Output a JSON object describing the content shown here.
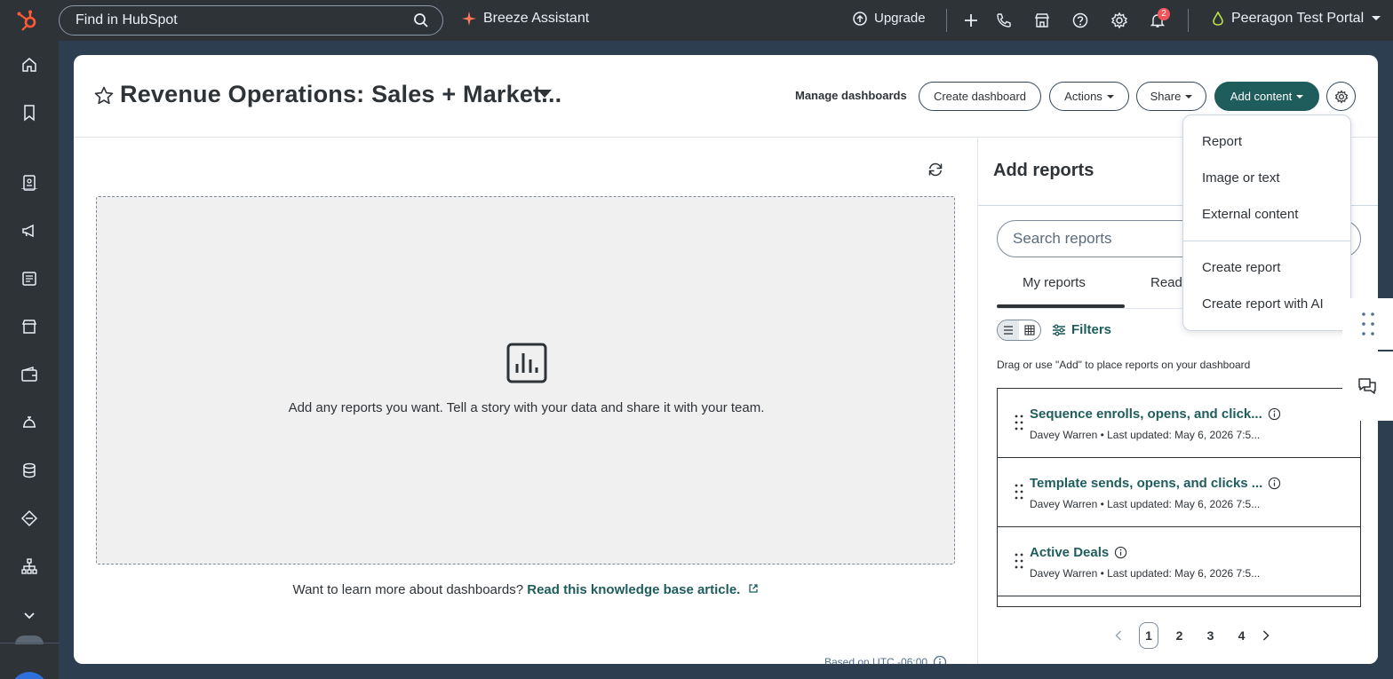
{
  "topbar": {
    "search_placeholder": "Find in HubSpot",
    "assistant_label": "Breeze Assistant",
    "upgrade_label": "Upgrade",
    "notification_count": "2",
    "portal_name": "Peeragon Test Portal"
  },
  "dashboard": {
    "title": "Revenue Operations: Sales + Market...",
    "manage_label": "Manage dashboards",
    "create_label": "Create dashboard",
    "actions_label": "Actions",
    "share_label": "Share",
    "add_content_label": "Add content"
  },
  "canvas": {
    "empty_text": "Add any reports you want. Tell a story with your data and share it with your team.",
    "learn_prefix": "Want to learn more about dashboards?",
    "learn_link": "Read this knowledge base article.",
    "timezone": "Based on UTC -06:00"
  },
  "panel": {
    "title": "Add reports",
    "search_placeholder": "Search reports",
    "tabs": [
      "My reports",
      "Ready"
    ],
    "filters_label": "Filters",
    "hint": "Drag or use \"Add\" to place reports on your dashboard",
    "reports": [
      {
        "title": "Sequence enrolls, opens, and click...",
        "meta": "Davey Warren • Last updated: May 6, 2026 7:5..."
      },
      {
        "title": "Template sends, opens, and clicks ...",
        "meta": "Davey Warren • Last updated: May 6, 2026 7:5..."
      },
      {
        "title": "Active Deals",
        "meta": "Davey Warren • Last updated: May 6, 2026 7:5..."
      }
    ],
    "pages": [
      "1",
      "2",
      "3",
      "4"
    ],
    "current_page": "1"
  },
  "menu": {
    "items_top": [
      "Report",
      "Image or text",
      "External content"
    ],
    "items_bottom": [
      "Create report",
      "Create report with AI"
    ]
  },
  "colors": {
    "topbar_bg": "#2e3338",
    "primary": "#1f5c5c",
    "hubspot_orange": "#ff5c35",
    "notification": "#f2545b",
    "timer_blue": "#2f6fdb"
  }
}
